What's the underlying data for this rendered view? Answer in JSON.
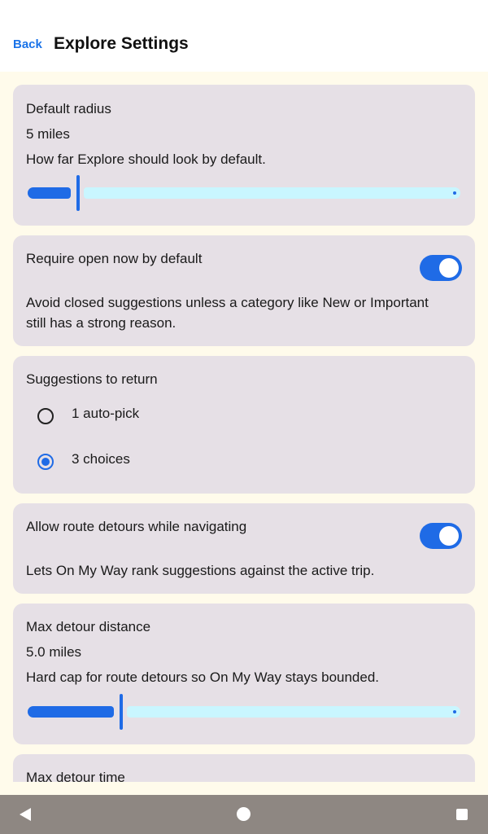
{
  "header": {
    "back_label": "Back",
    "title": "Explore Settings"
  },
  "default_radius": {
    "label": "Default radius",
    "value_text": "5 miles",
    "description": "How far Explore should look by default.",
    "slider_fraction": 0.11
  },
  "require_open": {
    "label": "Require open now by default",
    "enabled": true,
    "description_line1": "Avoid closed suggestions unless a category like New or Important",
    "description_line2": "still has a strong reason."
  },
  "suggestions": {
    "label": "Suggestions to return",
    "options": [
      {
        "label": "1 auto-pick",
        "selected": false
      },
      {
        "label": "3 choices",
        "selected": true
      }
    ]
  },
  "route_detours": {
    "label": "Allow route detours while navigating",
    "enabled": true,
    "description": "Lets On My Way rank suggestions against the active trip."
  },
  "max_detour_distance": {
    "label": "Max detour distance",
    "value_text": "5.0 miles",
    "description": "Hard cap for route detours so On My Way stays bounded.",
    "slider_fraction": 0.21
  },
  "max_detour_time": {
    "label": "Max detour time"
  },
  "colors": {
    "accent": "#1f6be6",
    "card": "#e6e0e6",
    "track_inactive": "#c9f6ff",
    "background": "#fffbeb"
  },
  "system_nav": {
    "icons": [
      "back-triangle-icon",
      "home-circle-icon",
      "recents-square-icon"
    ]
  }
}
